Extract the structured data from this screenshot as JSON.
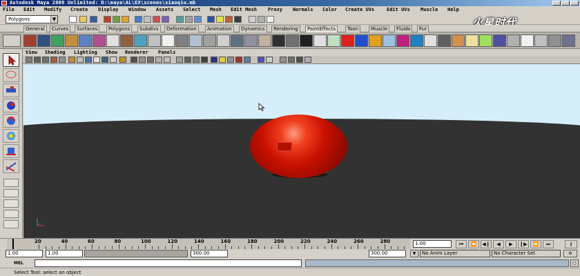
{
  "window": {
    "title": "Autodesk Maya 2009 Unlimited: D:\\maya\\AL\\EX\\scenes\\xiaoqiu.mb"
  },
  "menubar": [
    "File",
    "Edit",
    "Modify",
    "Create",
    "Display",
    "Window",
    "Assets",
    "Select",
    "Mesh",
    "Edit Mesh",
    "Proxy",
    "Normals",
    "Color",
    "Create UVs",
    "Edit UVs",
    "Muscle",
    "Help"
  ],
  "statusline": {
    "mode": "Polygons"
  },
  "shelf": {
    "tabs": [
      "General",
      "Curves",
      "Surfaces",
      "Polygons",
      "Subdivs",
      "Deformation",
      "Animation",
      "Dynamics",
      "Rendering",
      "PaintEffects",
      "Toon",
      "Muscle",
      "Fluids",
      "Fur"
    ],
    "active_tab": "PaintEffects"
  },
  "panel": {
    "menu": [
      "View",
      "Shading",
      "Lighting",
      "Show",
      "Renderer",
      "Panels"
    ]
  },
  "timeslider": {
    "ticks": [
      "20",
      "40",
      "60",
      "80",
      "100",
      "120",
      "140",
      "160",
      "180",
      "200",
      "220",
      "240",
      "260",
      "280"
    ],
    "current_frame": "1.00"
  },
  "range": {
    "start_time": "1.00",
    "playback_start": "1.00",
    "playback_end": "300.00",
    "end_time": "300.00",
    "anim_layer": "No Anim Layer",
    "character_set": "No Character Set"
  },
  "command": {
    "label": "MEL"
  },
  "helpline": {
    "text": "Select Tool: select an object"
  },
  "watermark": "火星时代",
  "colors": {
    "titlebar": "#0a246a",
    "sky": "#d6eefa",
    "ground": "#323232",
    "sphere": "#c81000"
  }
}
